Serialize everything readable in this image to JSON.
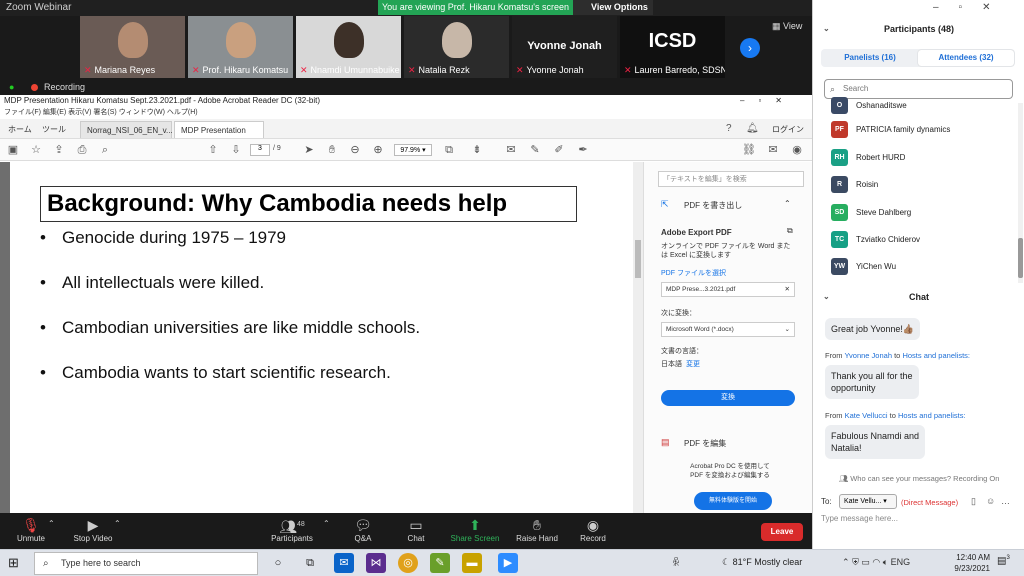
{
  "zoom": {
    "window_title": "Zoom Webinar",
    "viewing_banner": "You are viewing Prof. Hikaru Komatsu's screen",
    "view_options": "View Options",
    "gallery_view_label": "View",
    "recording_label": "Recording",
    "participants_tiles": [
      {
        "name": "Mariana Reyes"
      },
      {
        "name": "Prof. Hikaru Komatsu"
      },
      {
        "name": "Nnamdi Umunnabuike"
      },
      {
        "name": "Natalia Rezk"
      },
      {
        "name": "Yvonne Jonah",
        "big_name": "Yvonne Jonah"
      },
      {
        "name": "Lauren Barredo, SDSN",
        "logo": "ICSD"
      }
    ],
    "controls": {
      "unmute": "Unmute",
      "stop_video": "Stop Video",
      "participants": "Participants",
      "participants_count": "48",
      "qa": "Q&A",
      "chat": "Chat",
      "share_screen": "Share Screen",
      "raise_hand": "Raise Hand",
      "record": "Record",
      "leave": "Leave"
    }
  },
  "acrobat": {
    "title": "MDP Presentation Hikaru Komatsu Sept.23.2021.pdf - Adobe Acrobat Reader DC (32-bit)",
    "menu": "ファイル(F)   編集(E)   表示(V)   署名(S)   ウィンドウ(W)   ヘルプ(H)",
    "tabs": {
      "home": "ホーム",
      "tools": "ツール",
      "doc1": "Norrag_NSI_06_EN_v...",
      "doc2": "MDP Presentation Hik...",
      "login": "ログイン"
    },
    "page_current": "3",
    "page_total": "/ 9",
    "zoom": "97.9%",
    "slide": {
      "title": "Background: Why Cambodia needs help",
      "bullets": [
        "Genocide during 1975 – 1979",
        "All intellectuals were killed.",
        "Cambodian universities are like middle schools.",
        "Cambodia wants to start scientific research."
      ]
    },
    "tools_pane": {
      "search_placeholder": "「テキストを編集」を検索",
      "export_pdf": "PDF を書き出し",
      "adobe_export": "Adobe Export PDF",
      "export_desc": "オンラインで PDF ファイルを Word または Excel に変換します",
      "select_file": "PDF ファイルを選択",
      "file_name": "MDP Prese...3.2021.pdf",
      "convert_to": "次に変換：",
      "format": "Microsoft Word (*.docx)",
      "doc_lang_label": "文書の言語：",
      "doc_lang": "日本語",
      "change": "変更",
      "convert_btn": "変換",
      "edit_pdf": "PDF を編集",
      "pro_text": "Acrobat Pro DC を使用して PDF を変換および編集する",
      "trial_btn": "無料体験版を開始"
    }
  },
  "panel": {
    "participants_title": "Participants (48)",
    "tab_panelists": "Panelists (16)",
    "tab_attendees": "Attendees (32)",
    "search_placeholder": "Search",
    "participants": [
      {
        "initials": "O",
        "name": "Oshanaditswe",
        "color": "#3a4a66"
      },
      {
        "initials": "PF",
        "name": "PATRICIA family dynamics",
        "color": "#c0392b"
      },
      {
        "initials": "RH",
        "name": "Robert HURD",
        "color": "#1aa085"
      },
      {
        "initials": "R",
        "name": "Roisin",
        "color": "#3b4a62"
      },
      {
        "initials": "SD",
        "name": "Steve Dahlberg",
        "color": "#27ae60"
      },
      {
        "initials": "TC",
        "name": "Tzviatko Chiderov",
        "color": "#16a085"
      },
      {
        "initials": "YW",
        "name": "YiChen Wu",
        "color": "#3b4a62"
      }
    ],
    "chat_title": "Chat",
    "messages": [
      {
        "text": "Great job Yvonne!👍🏽"
      },
      {
        "from": "Yvonne Jonah",
        "to": "Hosts and panelists:",
        "text1": "Thank you all for the",
        "text2": "opportunity"
      },
      {
        "from": "Kate Vellucci",
        "to": "Hosts and panelists:",
        "text1": "Fabulous Nnamdi and",
        "text2": "Natalia!"
      }
    ],
    "from_word": "From",
    "to_word": "to",
    "chat_info": "Who can see your messages? Recording On",
    "chat_to_label": "To:",
    "chat_to_value": "Kate Vellu...",
    "direct_message": "(Direct Message)",
    "chat_placeholder": "Type message here..."
  },
  "taskbar": {
    "search_placeholder": "Type here to search",
    "weather": "81°F  Mostly clear",
    "lang": "ENG",
    "time": "12:40 AM",
    "date": "9/23/2021",
    "notif_count": "3"
  }
}
